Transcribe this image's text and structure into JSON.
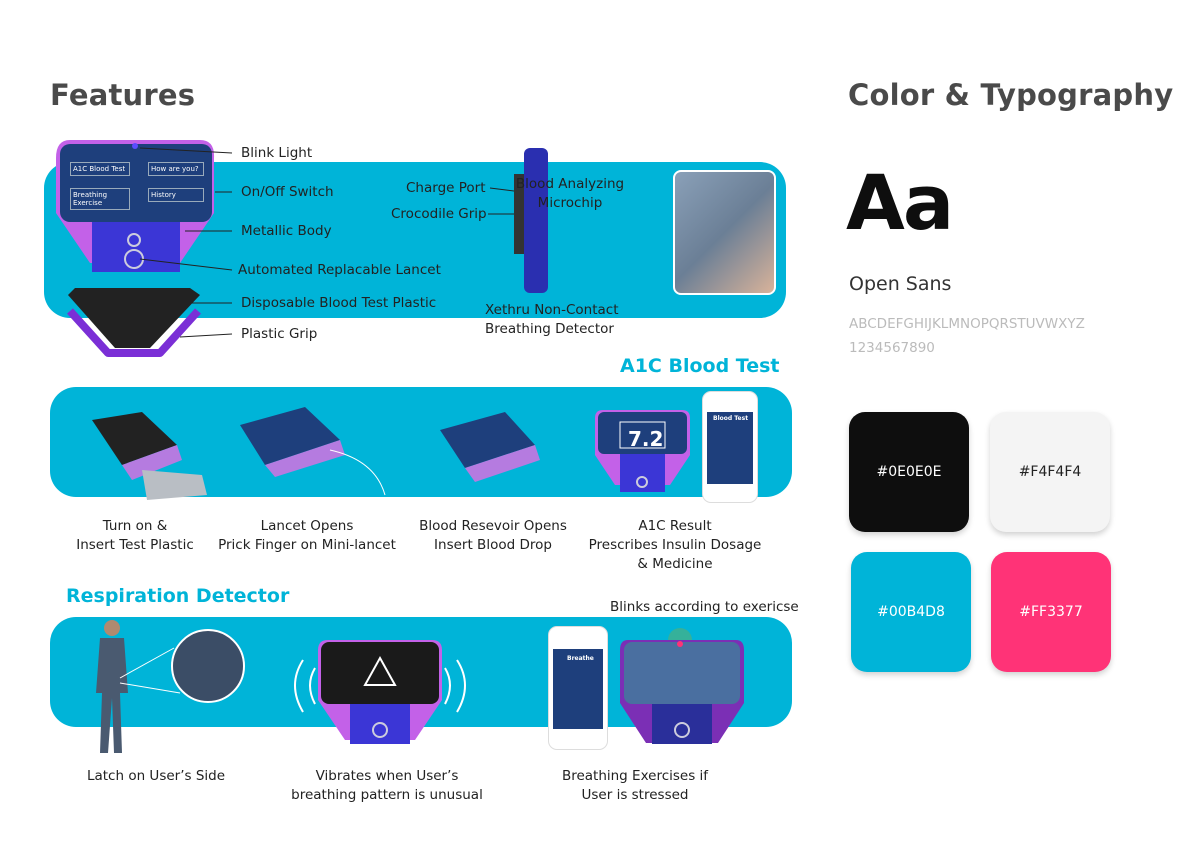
{
  "features": {
    "title": "Features",
    "callouts": [
      "Blink Light",
      "On/Off Switch",
      "Metallic Body",
      "Automated Replacable Lancet",
      "Disposable Blood Test Plastic",
      "Plastic Grip"
    ],
    "device_screen": [
      "A1C Blood Test",
      "How are you?",
      "Breathing Exercise",
      "History"
    ],
    "clip": {
      "charge_port": "Charge Port",
      "crocodile_grip": "Crocodile Grip",
      "detector_1": "Xethru Non-Contact",
      "detector_2": "Breathing Detector"
    },
    "chip": {
      "line1": "Blood Analyzing",
      "line2": "Microchip"
    }
  },
  "a1c": {
    "title": "A1C Blood Test",
    "reading": "7.2",
    "phone_title": "Blood Test",
    "steps": [
      {
        "line1": "Turn on &",
        "line2": "Insert Test Plastic"
      },
      {
        "line1": "Lancet Opens",
        "line2": "Prick Finger on Mini-lancet"
      },
      {
        "line1": "Blood Resevoir Opens",
        "line2": "Insert Blood Drop"
      },
      {
        "line1": "A1C Result",
        "line2": "Prescribes Insulin Dosage",
        "line3": "& Medicine"
      }
    ]
  },
  "respiration": {
    "title": "Respiration Detector",
    "note": "Blinks according to exericse",
    "phone_title": "Breathe",
    "steps": [
      {
        "line1": "Latch on User’s Side"
      },
      {
        "line1": "Vibrates when User’s",
        "line2": "breathing pattern is unusual"
      },
      {
        "line1": "Breathing Exercises if",
        "line2": "User is stressed"
      }
    ]
  },
  "style": {
    "title": "Color & Typography",
    "sample": "Aa",
    "font_name": "Open Sans",
    "alphabet": "ABCDEFGHIJKLMNOPQRSTUVWXYZ",
    "digits": "1234567890",
    "swatches": [
      {
        "hex": "#0E0E0E",
        "text": "#fff"
      },
      {
        "hex": "#F4F4F4",
        "text": "#222"
      },
      {
        "hex": "#00B4D8",
        "text": "#fff"
      },
      {
        "hex": "#FF3377",
        "text": "#fff"
      }
    ]
  }
}
